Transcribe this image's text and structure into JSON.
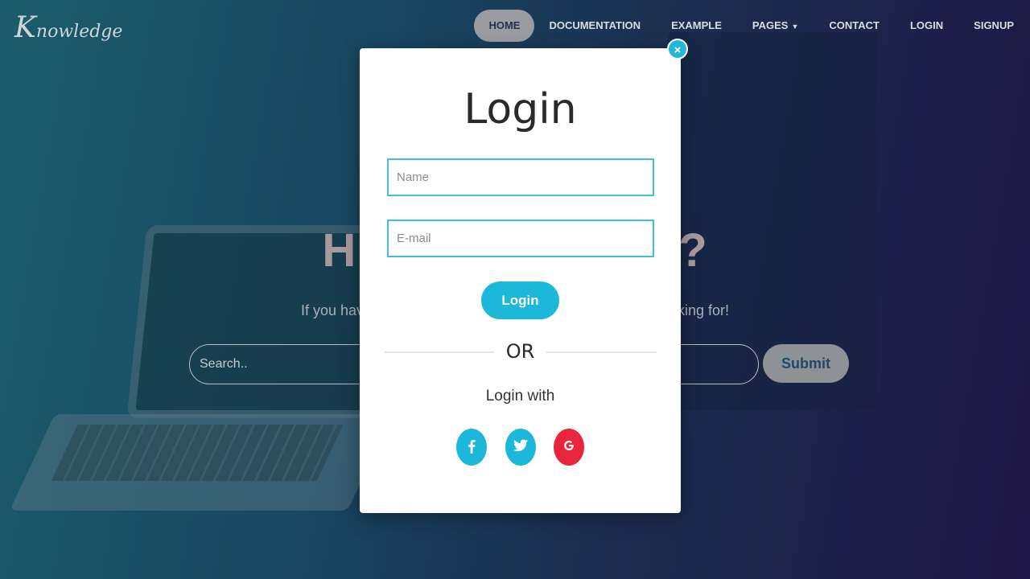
{
  "brand": {
    "logo_initial": "K",
    "logo_rest": "nowledge"
  },
  "nav": {
    "items": [
      {
        "label": "HOME"
      },
      {
        "label": "DOCUMENTATION"
      },
      {
        "label": "EXAMPLE"
      },
      {
        "label": "PAGES"
      },
      {
        "label": "CONTACT"
      },
      {
        "label": "LOGIN"
      },
      {
        "label": "SIGNUP"
      }
    ],
    "active": "HOME"
  },
  "hero": {
    "title_left": "H",
    "title_right": "?",
    "subtitle_left": "If you hav",
    "subtitle_right": "oking for!",
    "search_placeholder": "Search..",
    "submit_label": "Submit"
  },
  "modal": {
    "title": "Login",
    "name_placeholder": "Name",
    "email_placeholder": "E-mail",
    "login_button": "Login",
    "or_text": "OR",
    "login_with": "Login with",
    "close_symbol": "×",
    "social": [
      {
        "icon": "facebook-icon",
        "glyph": "f",
        "color": "#1cb8d9"
      },
      {
        "icon": "twitter-icon",
        "glyph": "t",
        "color": "#1cb8d9"
      },
      {
        "icon": "google-icon",
        "glyph": "G",
        "color": "#e8263b"
      }
    ]
  },
  "colors": {
    "accent": "#1cb8d9",
    "google": "#e8263b",
    "nav_active_bg": "#9a9ca2"
  }
}
